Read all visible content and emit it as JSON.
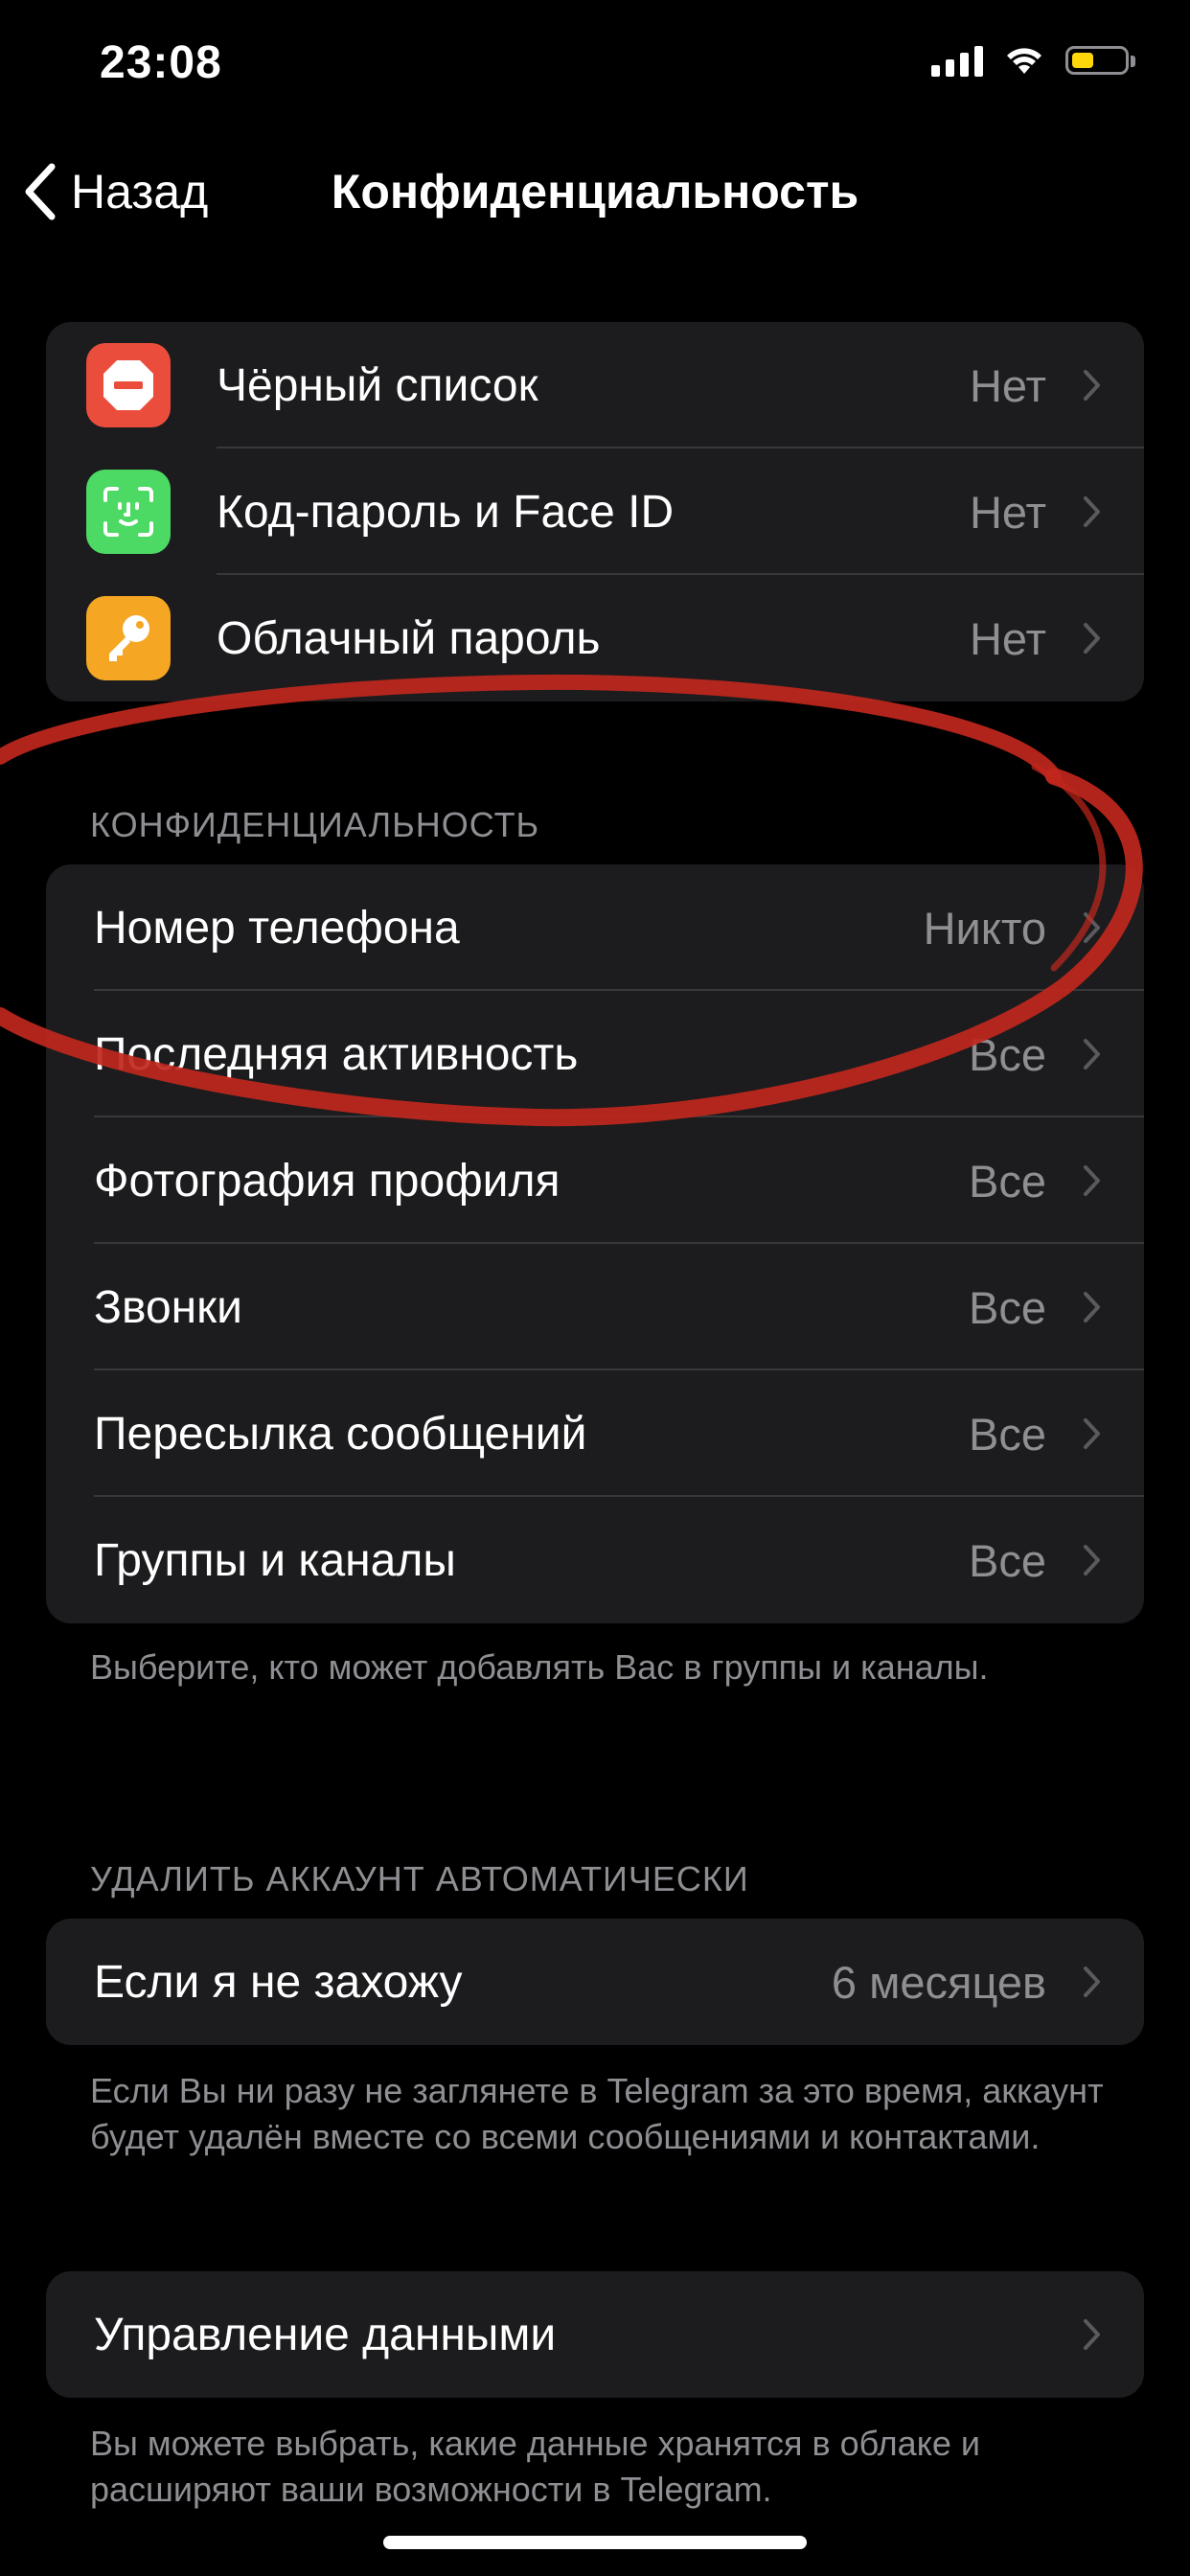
{
  "status_bar": {
    "time": "23:08",
    "icons": [
      "signal-bars-icon",
      "wifi-icon",
      "battery-icon"
    ],
    "battery_color": "#ffd60a"
  },
  "nav": {
    "back_label": "Назад",
    "title": "Конфиденциальность"
  },
  "security": {
    "items": [
      {
        "label": "Чёрный список",
        "value": "Нет",
        "icon": "blocked-icon",
        "color": "#eb4d3d"
      },
      {
        "label": "Код-пароль и Face ID",
        "value": "Нет",
        "icon": "face-id-icon",
        "color": "#4cd964"
      },
      {
        "label": "Облачный пароль",
        "value": "Нет",
        "icon": "key-icon",
        "color": "#f5a623"
      }
    ]
  },
  "privacy": {
    "header": "КОНФИДЕНЦИАЛЬНОСТЬ",
    "items": [
      {
        "label": "Номер телефона",
        "value": "Никто"
      },
      {
        "label": "Последняя активность",
        "value": "Все"
      },
      {
        "label": "Фотография профиля",
        "value": "Все"
      },
      {
        "label": "Звонки",
        "value": "Все"
      },
      {
        "label": "Пересылка сообщений",
        "value": "Все"
      },
      {
        "label": "Группы и каналы",
        "value": "Все"
      }
    ],
    "footer": "Выберите, кто может добавлять Вас в группы и каналы."
  },
  "delete_account": {
    "header": "УДАЛИТЬ АККАУНТ АВТОМАТИЧЕСКИ",
    "label": "Если я не захожу",
    "value": "6 месяцев",
    "footer": "Если Вы ни разу не заглянете в Telegram за это время, аккаунт будет удалён вместе со всеми сообщениями и контактами."
  },
  "data_management": {
    "label": "Управление данными",
    "footer": "Вы можете выбрать, какие данные хранятся в облаке и расширяют ваши возможности в Telegram."
  },
  "annotation_color": "#c0271d"
}
